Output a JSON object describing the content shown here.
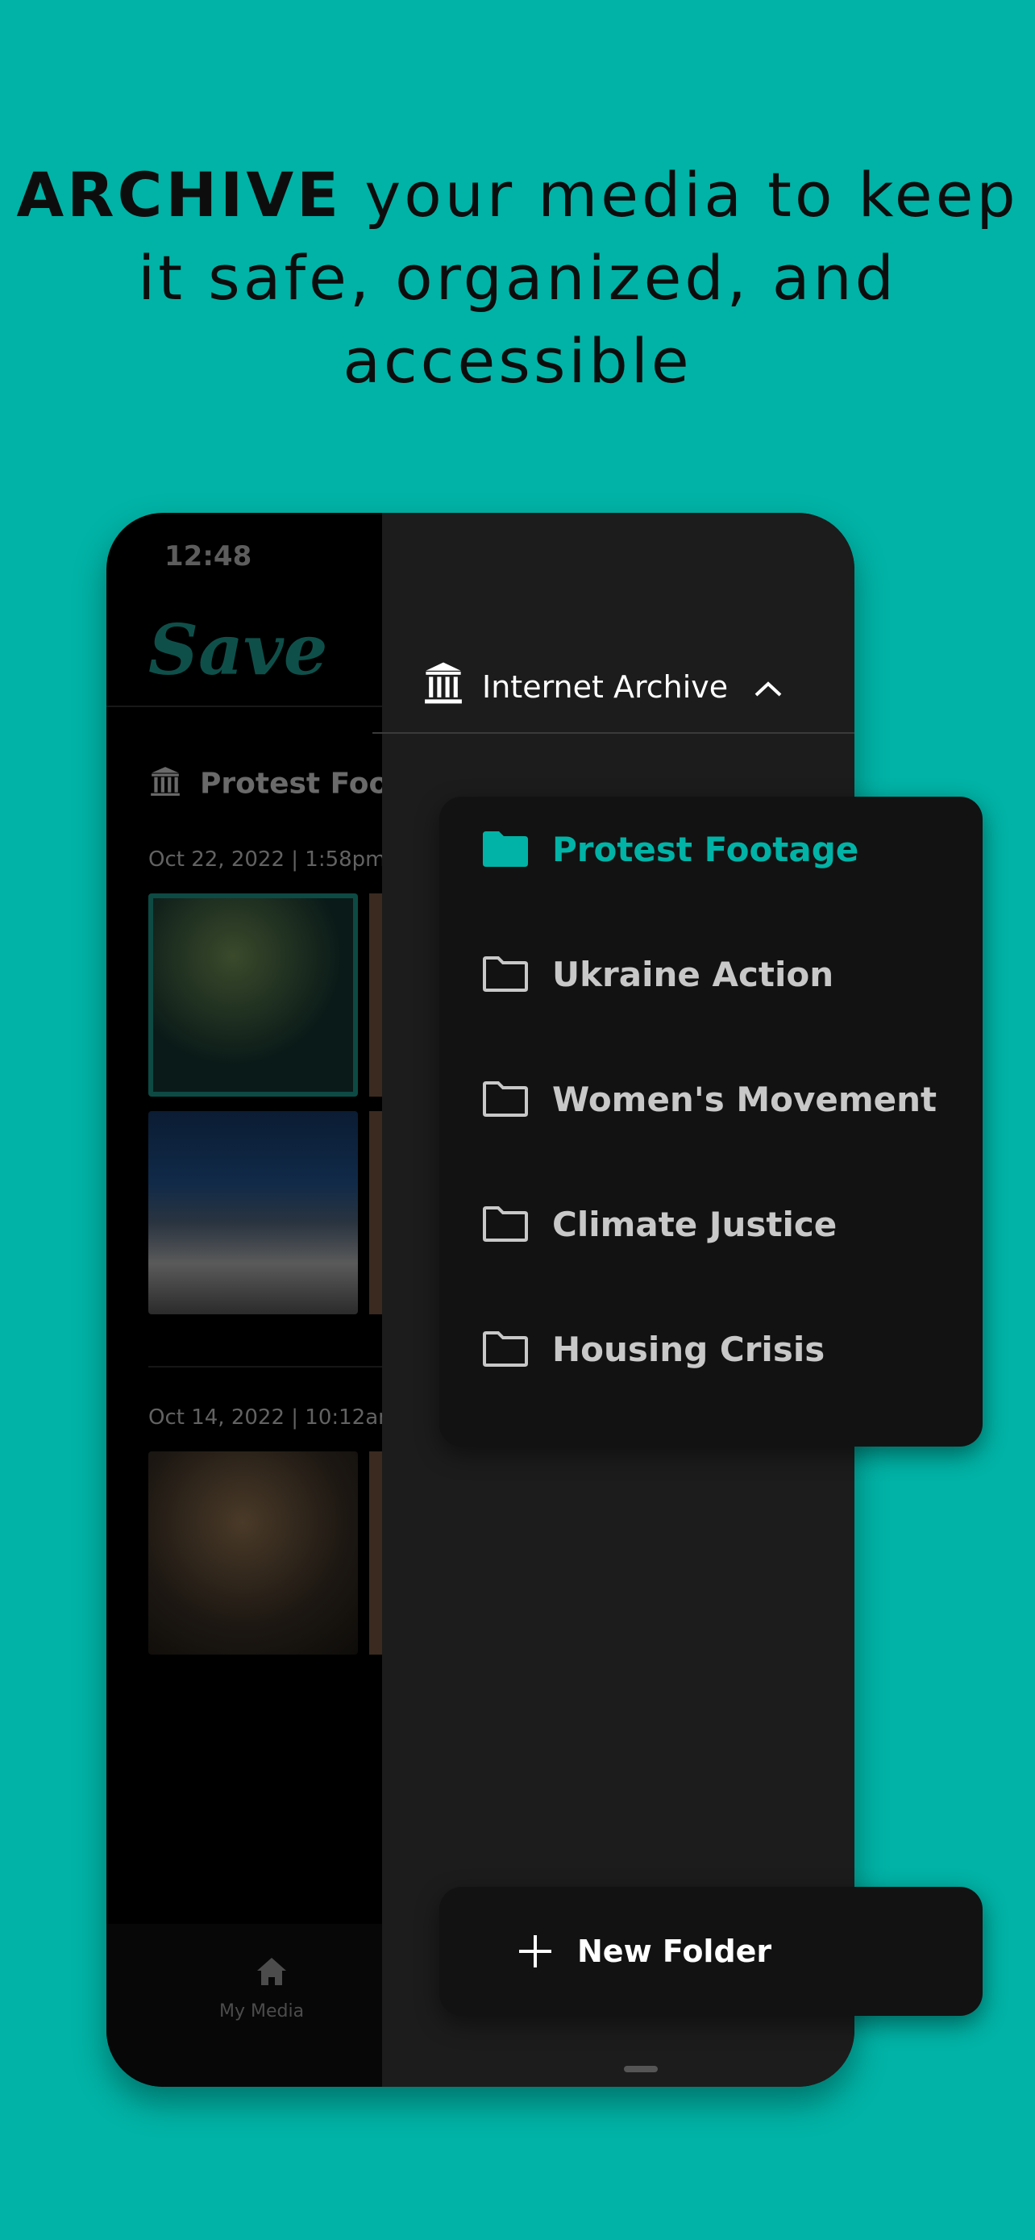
{
  "headline": {
    "bold": "ARCHIVE",
    "rest": " your media to keep it safe, organized, and accessible"
  },
  "phone": {
    "status_time": "12:48",
    "logo_text": "Save",
    "folder_title": "Protest Footage",
    "groups": [
      {
        "date": "Oct 22, 2022 | 1:58pm"
      },
      {
        "date": "Oct 14, 2022 | 10:12am"
      }
    ],
    "bottom_nav": {
      "my_media_label": "My Media"
    }
  },
  "drawer": {
    "server_name": "Internet Archive",
    "folders": [
      {
        "label": "Protest Footage",
        "active": true
      },
      {
        "label": "Ukraine Action",
        "active": false
      },
      {
        "label": "Women's Movement",
        "active": false
      },
      {
        "label": "Climate Justice",
        "active": false
      },
      {
        "label": "Housing Crisis",
        "active": false
      }
    ],
    "new_folder_label": "New Folder"
  },
  "colors": {
    "background": "#00b3a6",
    "accent": "#00b3a6",
    "phone": "#000000",
    "drawer": "#1c1c1c",
    "menu": "#121212"
  },
  "icons": [
    "institution-icon",
    "chevron-up-icon",
    "folder-filled-icon",
    "folder-outline-icon",
    "plus-icon",
    "home-icon"
  ]
}
